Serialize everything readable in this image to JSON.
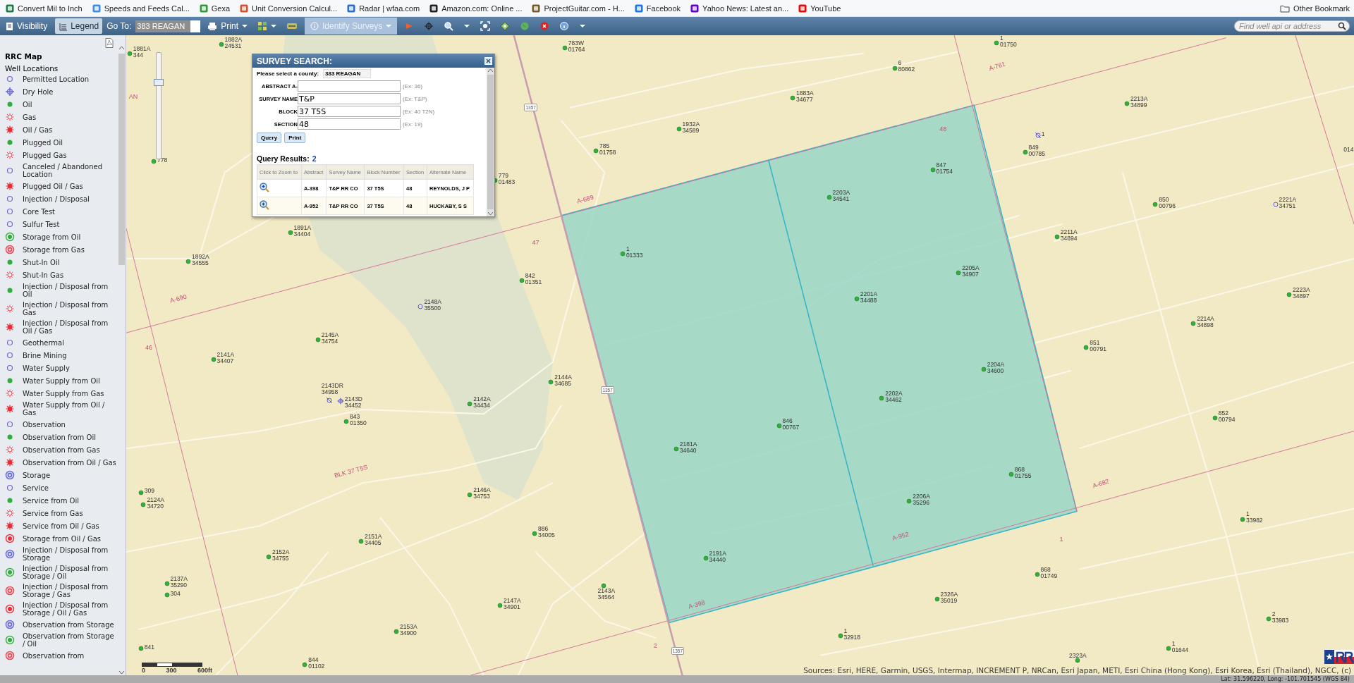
{
  "bookmarks": [
    {
      "label": "Convert Mil to Inch"
    },
    {
      "label": "Speeds and Feeds Cal..."
    },
    {
      "label": "Gexa"
    },
    {
      "label": "Unit Conversion Calcul..."
    },
    {
      "label": "Radar | wfaa.com"
    },
    {
      "label": "Amazon.com: Online ..."
    },
    {
      "label": "ProjectGuitar.com - H..."
    },
    {
      "label": "Facebook"
    },
    {
      "label": "Yahoo News: Latest an..."
    },
    {
      "label": "YouTube"
    }
  ],
  "other_bookmarks": "Other Bookmark",
  "toolbar": {
    "tabs": [
      {
        "label": "Visibility",
        "selected": false
      },
      {
        "label": "Legend",
        "selected": true
      }
    ],
    "goto_label": "Go To:",
    "goto_value": "383 REAGAN",
    "print": "Print",
    "identify": {
      "label": "Identify Surveys",
      "active": true
    },
    "search": {
      "placeholder": "Find well api or address"
    }
  },
  "legend": {
    "title": "RRC Map",
    "group": "Well Locations",
    "items": [
      {
        "label": "Permitted Location",
        "kind": "ring",
        "color": "#6b6bd6"
      },
      {
        "label": "Dry Hole",
        "kind": "cross-ring",
        "color": "#6b6bd6"
      },
      {
        "label": "Oil",
        "kind": "dot",
        "color": "#2fae3a"
      },
      {
        "label": "Gas",
        "kind": "star",
        "color": "#ee4a55"
      },
      {
        "label": "Oil / Gas",
        "kind": "starfill",
        "color": "#ee2a35"
      },
      {
        "label": "Plugged Oil",
        "kind": "dot",
        "color": "#2fae3a"
      },
      {
        "label": "Plugged Gas",
        "kind": "star",
        "color": "#ee4a55"
      },
      {
        "label": "Canceled / Abandoned Location",
        "kind": "ring",
        "color": "#6b6bd6"
      },
      {
        "label": "Plugged Oil / Gas",
        "kind": "starfill",
        "color": "#ee2a35"
      },
      {
        "label": "Injection / Disposal",
        "kind": "ring",
        "color": "#6b6bd6"
      },
      {
        "label": "Core Test",
        "kind": "ring",
        "color": "#6b6bd6"
      },
      {
        "label": "Sulfur Test",
        "kind": "ring",
        "color": "#6b6bd6"
      },
      {
        "label": "Storage from Oil",
        "kind": "dot-ring",
        "color": "#2fae3a"
      },
      {
        "label": "Storage from Gas",
        "kind": "double-ring",
        "color": "#ee4a55"
      },
      {
        "label": "Shut-In Oil",
        "kind": "dot",
        "color": "#2fae3a"
      },
      {
        "label": "Shut-In Gas",
        "kind": "star",
        "color": "#ee4a55"
      },
      {
        "label": "Injection / Disposal from Oil",
        "kind": "dot",
        "color": "#2fae3a"
      },
      {
        "label": "Injection / Disposal from Gas",
        "kind": "star",
        "color": "#ee4a55"
      },
      {
        "label": "Injection / Disposal from Oil / Gas",
        "kind": "starfill",
        "color": "#ee2a35"
      },
      {
        "label": "Geothermal",
        "kind": "ring",
        "color": "#6b6bd6"
      },
      {
        "label": "Brine Mining",
        "kind": "ring",
        "color": "#6b6bd6"
      },
      {
        "label": "Water Supply",
        "kind": "ring",
        "color": "#6b6bd6"
      },
      {
        "label": "Water Supply from Oil",
        "kind": "dot",
        "color": "#2fae3a"
      },
      {
        "label": "Water Supply from Gas",
        "kind": "star",
        "color": "#ee4a55"
      },
      {
        "label": "Water Supply from Oil / Gas",
        "kind": "starfill",
        "color": "#ee2a35"
      },
      {
        "label": "Observation",
        "kind": "ring",
        "color": "#6b6bd6"
      },
      {
        "label": "Observation from Oil",
        "kind": "dot",
        "color": "#2fae3a"
      },
      {
        "label": "Observation from Gas",
        "kind": "star",
        "color": "#ee4a55"
      },
      {
        "label": "Observation from Oil / Gas",
        "kind": "starfill",
        "color": "#ee2a35"
      },
      {
        "label": "Storage",
        "kind": "double-ring",
        "color": "#6b6bd6"
      },
      {
        "label": "Service",
        "kind": "ring",
        "color": "#6b6bd6"
      },
      {
        "label": "Service from Oil",
        "kind": "dot",
        "color": "#2fae3a"
      },
      {
        "label": "Service from Gas",
        "kind": "star",
        "color": "#ee4a55"
      },
      {
        "label": "Service from Oil / Gas",
        "kind": "starfill",
        "color": "#ee2a35"
      },
      {
        "label": "Storage from Oil / Gas",
        "kind": "dot-ring",
        "color": "#ee2a35"
      },
      {
        "label": "Injection / Disposal from Storage",
        "kind": "double-ring",
        "color": "#6b6bd6"
      },
      {
        "label": "Injection / Disposal from Storage / Oil",
        "kind": "dot-ring",
        "color": "#2fae3a"
      },
      {
        "label": "Injection / Disposal from Storage / Gas",
        "kind": "double-ring",
        "color": "#ee4a55"
      },
      {
        "label": "Injection / Disposal from Storage / Oil / Gas",
        "kind": "dot-ring",
        "color": "#ee2a35"
      },
      {
        "label": "Observation from Storage",
        "kind": "double-ring",
        "color": "#6b6bd6"
      },
      {
        "label": "Observation from Storage / Oil",
        "kind": "dot-ring",
        "color": "#2fae3a"
      },
      {
        "label": "Observation from",
        "kind": "double-ring",
        "color": "#ee4a55"
      }
    ]
  },
  "map": {
    "zoom_slider": {
      "level": 0.73
    },
    "wells": [
      {
        "name": "1881A",
        "number": "344",
        "kind": "oil"
      },
      {
        "name": "1882A",
        "number": "24531",
        "kind": "oil"
      },
      {
        "name": "783W",
        "number": "01764",
        "kind": "oil"
      },
      {
        "name": "1",
        "number": "01750",
        "kind": "oil"
      },
      {
        "name": "6",
        "number": "80862",
        "kind": "oil"
      },
      {
        "name": "1883A",
        "number": "34677",
        "kind": "oil"
      },
      {
        "name": "2213A",
        "number": "34899",
        "kind": "oil"
      },
      {
        "name": "1932A",
        "number": "34589",
        "kind": "oil"
      },
      {
        "name": "785",
        "number": "01758",
        "kind": "oil"
      },
      {
        "name": "1",
        "kind": "canceled"
      },
      {
        "name": "849",
        "number": "00785",
        "kind": "oil"
      },
      {
        "name": "778",
        "kind": "oil"
      },
      {
        "name": "779",
        "number": "01483",
        "kind": "oil"
      },
      {
        "name": "847",
        "number": "01754",
        "kind": "oil"
      },
      {
        "name": "2203A",
        "number": "34541",
        "kind": "oil"
      },
      {
        "name": "850",
        "number": "00796",
        "kind": "oil"
      },
      {
        "name": "2221A",
        "number": "34751",
        "kind": "permitted"
      },
      {
        "name": "1891A",
        "number": "34404",
        "kind": "oil"
      },
      {
        "name": "2211A",
        "number": "34894",
        "kind": "oil"
      },
      {
        "name": "1",
        "number": "01333",
        "kind": "oil"
      },
      {
        "name": "1892A",
        "number": "34555",
        "kind": "oil"
      },
      {
        "name": "842",
        "number": "01351",
        "kind": "oil"
      },
      {
        "name": "2205A",
        "number": "34907",
        "kind": "oil"
      },
      {
        "name": "2201A",
        "number": "34488",
        "kind": "oil"
      },
      {
        "name": "2223A",
        "number": "34897",
        "kind": "oil"
      },
      {
        "name": "2148A",
        "number": "35500",
        "kind": "permitted"
      },
      {
        "name": "2145A",
        "number": "34754",
        "kind": "oil"
      },
      {
        "name": "2214A",
        "number": "34898",
        "kind": "oil"
      },
      {
        "name": "851",
        "number": "00791",
        "kind": "oil"
      },
      {
        "name": "2141A",
        "number": "34407",
        "kind": "oil"
      },
      {
        "name": "2204A",
        "number": "34600",
        "kind": "oil"
      },
      {
        "name": "2144A",
        "number": "34685",
        "kind": "oil"
      },
      {
        "name": "2143DR",
        "number": "34958",
        "kind": "canceled"
      },
      {
        "name": "2143D",
        "number": "34452",
        "kind": "dry"
      },
      {
        "name": "2142A",
        "number": "34434",
        "kind": "oil"
      },
      {
        "name": "2202A",
        "number": "34462",
        "kind": "oil"
      },
      {
        "name": "843",
        "number": "01350",
        "kind": "oil"
      },
      {
        "name": "852",
        "number": "00794",
        "kind": "oil"
      },
      {
        "name": "846",
        "number": "00767",
        "kind": "oil"
      },
      {
        "name": "2181A",
        "number": "34640",
        "kind": "oil"
      },
      {
        "name": "868",
        "number": "01755",
        "kind": "oil"
      },
      {
        "name": "2146A",
        "number": "34753",
        "kind": "oil"
      },
      {
        "name": "2206A",
        "number": "35296",
        "kind": "oil"
      },
      {
        "name": "309",
        "kind": "oil"
      },
      {
        "name": "2124A",
        "number": "34720",
        "kind": "oil"
      },
      {
        "name": "1",
        "number": "33982",
        "kind": "oil"
      },
      {
        "name": "886",
        "number": "34005",
        "kind": "oil"
      },
      {
        "name": "2151A",
        "number": "34405",
        "kind": "oil"
      },
      {
        "name": "2152A",
        "number": "34755",
        "kind": "oil"
      },
      {
        "name": "2191A",
        "number": "34440",
        "kind": "oil"
      },
      {
        "name": "868",
        "number": "01749",
        "kind": "oil"
      },
      {
        "name": "2137A",
        "number": "35290",
        "kind": "oil"
      },
      {
        "name": "304",
        "kind": "oil"
      },
      {
        "name": "2143A",
        "number": "34564",
        "kind": "oil"
      },
      {
        "name": "2326A",
        "number": "35019",
        "kind": "oil"
      },
      {
        "name": "2147A",
        "number": "34901",
        "kind": "oil"
      },
      {
        "name": "2",
        "number": "33983",
        "kind": "oil"
      },
      {
        "name": "2153A",
        "number": "34900",
        "kind": "oil"
      },
      {
        "name": "1",
        "number": "32918",
        "kind": "oil"
      },
      {
        "name": "1",
        "number": "01644",
        "kind": "oil"
      },
      {
        "name": "841",
        "kind": "oil"
      },
      {
        "name": "844",
        "number": "01102",
        "kind": "oil"
      },
      {
        "name": "2323A",
        "kind": "oil"
      },
      {
        "name": "014",
        "kind": "label"
      }
    ],
    "labels": [
      {
        "text": "A-761"
      },
      {
        "text": "A-689"
      },
      {
        "text": "47"
      },
      {
        "text": "A-690"
      },
      {
        "text": "46"
      },
      {
        "text": "48"
      },
      {
        "text": "BLK 37 T5S"
      },
      {
        "text": "A-682"
      },
      {
        "text": "1"
      },
      {
        "text": "A-952"
      },
      {
        "text": "A-398"
      },
      {
        "text": "2"
      },
      {
        "text": "AN"
      }
    ],
    "road_shields": [
      "1357",
      "1357",
      "1357"
    ],
    "scale_bar": [
      "0",
      "300",
      "600ft"
    ],
    "attribution": "Sources: Esri, HERE, Garmin, USGS, Intermap, INCREMENT P, NRCan, Esri Japan, METI, Esri China (Hong Kong), Esri Korea, Esri (Thailand), NGCC, (c)"
  },
  "survey_search": {
    "title": "SURVEY SEARCH:",
    "county_label": "Please select a county:",
    "county": "383 REAGAN",
    "fields": [
      {
        "label": "ABSTRACT A-",
        "hint": "(Ex: 36)"
      },
      {
        "label": "SURVEY NAME",
        "value": "T&P",
        "hint": "(Ex: T&P)"
      },
      {
        "label": "BLOCK",
        "value": "37 T5S",
        "hint": "(Ex: 40 T2N)"
      },
      {
        "label": "SECTION",
        "value": "48",
        "hint": "(Ex: 19)"
      }
    ],
    "buttons": [
      "Query",
      "Print"
    ],
    "results_label": "Query Results:",
    "results_count": "2",
    "columns": [
      "Click to Zoom to",
      "Abstract",
      "Survey Name",
      "Block Number",
      "Section",
      "Alternate Name"
    ],
    "rows": [
      {
        "cells": [
          "",
          "A-398",
          "T&P RR CO",
          "37 T5S",
          "48",
          "REYNOLDS, J P"
        ]
      },
      {
        "cells": [
          "",
          "A-952",
          "T&P RR CO",
          "37 T5S",
          "48",
          "HUCKABY, S S"
        ]
      }
    ]
  },
  "status_bar": {
    "coordinates": "Lat: 31.596220, Long: -101.701545 (WGS 84)"
  }
}
